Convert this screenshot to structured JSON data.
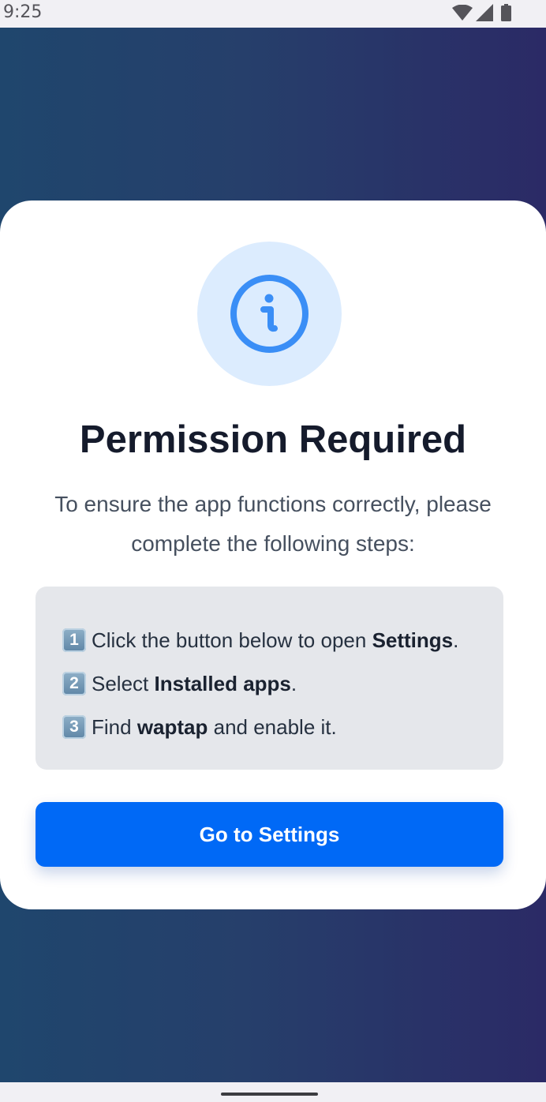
{
  "status_bar": {
    "time": "9:25",
    "icons": [
      "wifi-icon",
      "cellular-signal-icon",
      "battery-icon"
    ]
  },
  "dialog": {
    "icon": "info-icon",
    "title": "Permission Required",
    "subtitle": "To ensure the app functions correctly, please complete the following steps:",
    "steps": [
      {
        "number": "1",
        "pre": "Click the button below to open ",
        "bold": "Settings",
        "post": "."
      },
      {
        "number": "2",
        "pre": "Select ",
        "bold": "Installed apps",
        "post": "."
      },
      {
        "number": "3",
        "pre": "Find ",
        "bold": "waptap",
        "post": " and enable it."
      }
    ],
    "button_label": "Go to Settings"
  },
  "colors": {
    "background_gradient_start": "#1f466d",
    "background_gradient_end": "#2b2a66",
    "accent": "#0069f6",
    "icon_circle_bg": "#dcecfe",
    "icon_stroke": "#3a8ef6",
    "steps_box_bg": "#e5e7eb",
    "title_text": "#151b2c"
  }
}
